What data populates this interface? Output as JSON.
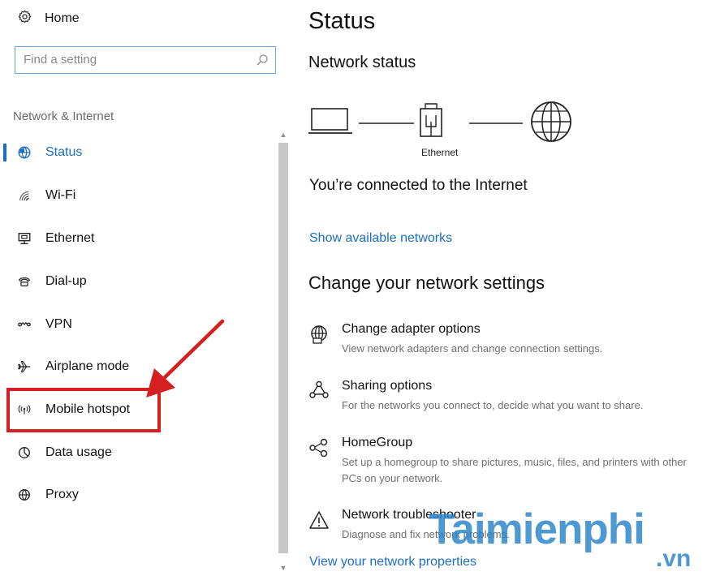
{
  "sidebar": {
    "home_label": "Home",
    "search_placeholder": "Find a setting",
    "section_label": "Network & Internet",
    "items": [
      {
        "label": "Status",
        "icon": "globe-status-icon",
        "active": true
      },
      {
        "label": "Wi-Fi",
        "icon": "wifi-icon"
      },
      {
        "label": "Ethernet",
        "icon": "ethernet-icon"
      },
      {
        "label": "Dial-up",
        "icon": "phone-icon"
      },
      {
        "label": "VPN",
        "icon": "vpn-icon"
      },
      {
        "label": "Airplane mode",
        "icon": "airplane-icon"
      },
      {
        "label": "Mobile hotspot",
        "icon": "hotspot-icon"
      },
      {
        "label": "Data usage",
        "icon": "pie-chart-icon"
      },
      {
        "label": "Proxy",
        "icon": "globe-icon"
      }
    ]
  },
  "main": {
    "title": "Status",
    "network_status_title": "Network status",
    "diagram_caption": "Ethernet",
    "connected_text": "You’re connected to the Internet",
    "show_networks_link": "Show available networks",
    "change_settings_title": "Change your network settings",
    "settings": [
      {
        "title": "Change adapter options",
        "description": "View network adapters and change connection settings.",
        "icon": "adapter-globe-icon"
      },
      {
        "title": "Sharing options",
        "description": "For the networks you connect to, decide what you want to share.",
        "icon": "sharing-icon"
      },
      {
        "title": "HomeGroup",
        "description": "Set up a homegroup to share pictures, music, files, and printers with other PCs on your network.",
        "icon": "homegroup-icon"
      },
      {
        "title": "Network troubleshooter",
        "description": "Diagnose and fix network problems.",
        "icon": "warning-icon"
      }
    ],
    "view_properties_link": "View your network properties"
  },
  "watermark": {
    "text": "Taimienphi",
    "tld": ".vn"
  },
  "colors": {
    "accent": "#1b6ec2",
    "highlight": "#d42020"
  }
}
